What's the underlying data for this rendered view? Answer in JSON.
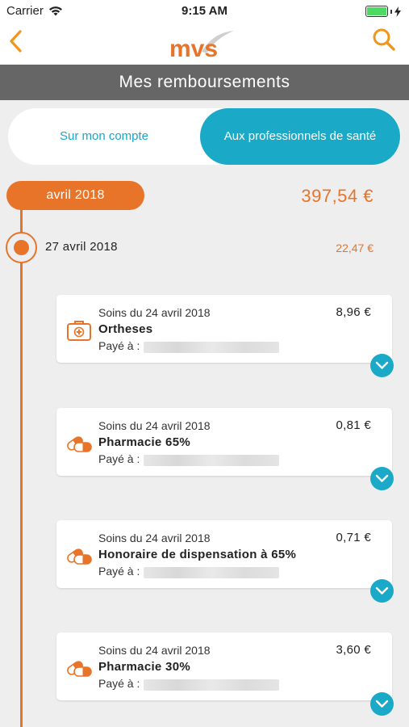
{
  "status_bar": {
    "carrier": "Carrier",
    "time": "9:15 AM"
  },
  "nav": {
    "logo_text": "mvs",
    "back_icon": "chevron-left-icon",
    "search_icon": "search-icon"
  },
  "title": "Mes remboursements",
  "tabs": [
    {
      "label": "Sur mon compte",
      "selected": false
    },
    {
      "label": "Aux professionnels de santé",
      "selected": true
    }
  ],
  "month": {
    "label": "avril 2018",
    "total": "397,54 €"
  },
  "day": {
    "label": "27 avril 2018",
    "total": "22,47 €"
  },
  "claims": [
    {
      "date": "Soins du 24 avril 2018",
      "label": "Ortheses",
      "amount": "8,96 €",
      "paid_label": "Payé à :",
      "icon": "medical-kit-icon"
    },
    {
      "date": "Soins du 24 avril 2018",
      "label": "Pharmacie 65%",
      "amount": "0,81 €",
      "paid_label": "Payé à :",
      "icon": "pill-capsule-icon"
    },
    {
      "date": "Soins du 24 avril 2018",
      "label": "Honoraire de dispensation à 65%",
      "amount": "0,71 €",
      "paid_label": "Payé à :",
      "icon": "pill-capsule-icon"
    },
    {
      "date": "Soins du 24 avril 2018",
      "label": "Pharmacie 30%",
      "amount": "3,60 €",
      "paid_label": "Payé à :",
      "icon": "pill-capsule-icon"
    }
  ],
  "colors": {
    "accent_orange": "#e8742a",
    "accent_blue": "#1ba9c8",
    "title_bar": "#666666",
    "background": "#eeeeee"
  }
}
